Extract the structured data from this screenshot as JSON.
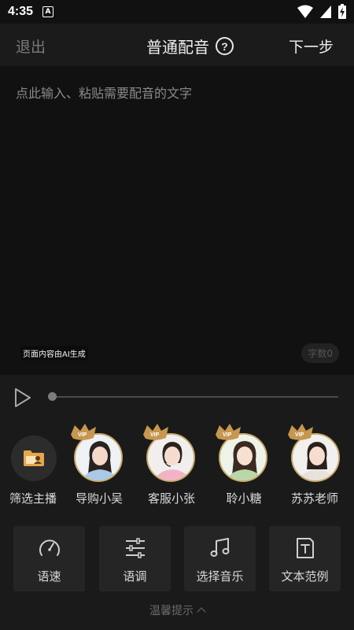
{
  "status": {
    "time": "4:35",
    "badge": "A"
  },
  "header": {
    "back_label": "退出",
    "title": "普通配音",
    "next_label": "下一步"
  },
  "editor": {
    "placeholder": "点此输入、粘贴需要配音的文字",
    "ai_note": "页面内容由AI生成",
    "word_count": "字数0"
  },
  "player": {
    "progress": 0
  },
  "voices": [
    {
      "label": "筛选主播",
      "vip": false,
      "type": "filter"
    },
    {
      "label": "导购小吴",
      "vip": true,
      "accent": "#a9c9e6"
    },
    {
      "label": "客服小张",
      "vip": true,
      "accent": "#f2b3c6"
    },
    {
      "label": "聆小糖",
      "vip": true,
      "accent": "#b9d7a8"
    },
    {
      "label": "苏苏老师",
      "vip": true,
      "accent": "#e8e2dc"
    }
  ],
  "tools": [
    {
      "label": "语速",
      "icon": "speedometer-icon"
    },
    {
      "label": "语调",
      "icon": "sliders-icon"
    },
    {
      "label": "选择音乐",
      "icon": "music-note-icon"
    },
    {
      "label": "文本范例",
      "icon": "text-document-icon"
    }
  ],
  "footer": {
    "tips_label": "温馨提示"
  },
  "colors": {
    "background": "#1a1a1a",
    "editor": "#111111",
    "vip_gold": "#c8a96a",
    "tile": "#252525"
  }
}
